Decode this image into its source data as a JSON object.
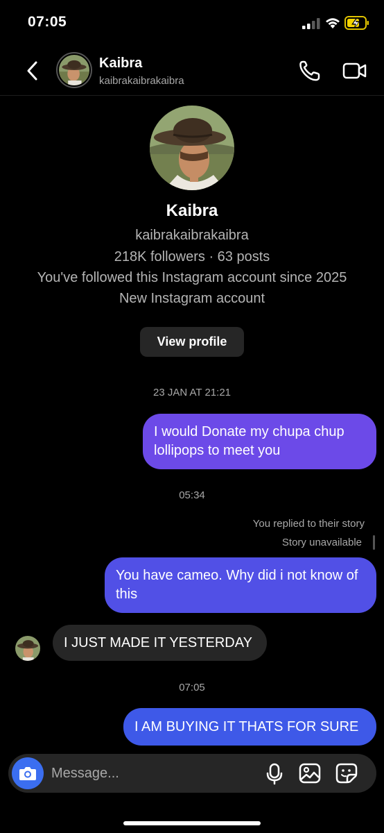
{
  "status_bar": {
    "time": "07:05"
  },
  "header": {
    "name": "Kaibra",
    "username": "kaibrakaibrakaibra",
    "icons": [
      "back-icon",
      "call-icon",
      "video-icon"
    ]
  },
  "profile": {
    "name": "Kaibra",
    "username": "kaibrakaibrakaibra",
    "stats": "218K followers · 63 posts",
    "followed_note": "You've followed this Instagram account since 2025",
    "account_note": "New Instagram account",
    "view_profile_label": "View profile"
  },
  "messages": [
    {
      "type": "timestamp",
      "text": "23 JAN AT 21:21"
    },
    {
      "type": "sent",
      "text": "I would Donate my chupa chup lollipops to meet you"
    },
    {
      "type": "timestamp",
      "text": "05:34"
    },
    {
      "type": "story_note",
      "text": "You replied to their story"
    },
    {
      "type": "story_note",
      "text": "Story unavailable"
    },
    {
      "type": "sent",
      "text": "You have cameo. Why did i not know of this"
    },
    {
      "type": "received",
      "text": "I JUST MADE IT YESTERDAY"
    },
    {
      "type": "timestamp",
      "text": "07:05"
    },
    {
      "type": "sent",
      "text": "I AM BUYING IT THATS FOR SURE"
    }
  ],
  "composer": {
    "placeholder": "Message...",
    "icons": [
      "camera-icon",
      "microphone-icon",
      "gallery-icon",
      "sticker-icon"
    ]
  },
  "colors": {
    "background": "#000000",
    "bubble_sent_1": "#6c4ae8",
    "bubble_sent_2": "#5150e6",
    "bubble_sent_3": "#3e59e8",
    "bubble_received": "#262626",
    "camera_button": "#3b6ef0"
  }
}
